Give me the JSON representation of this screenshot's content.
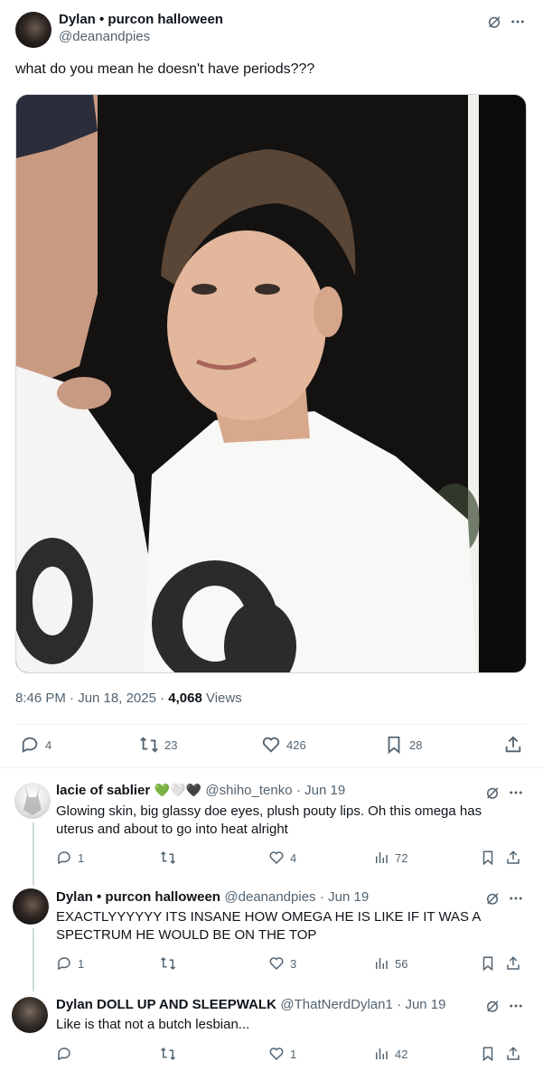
{
  "main_tweet": {
    "display_name": "Dylan • purcon halloween",
    "handle": "@deanandpies",
    "text": "what do you mean he doesn't have periods???",
    "time": "8:46 PM · Jun 18, 2025 · ",
    "views_count": "4,068",
    "views_label": " Views",
    "stats": {
      "replies": "4",
      "reposts": "23",
      "likes": "426",
      "bookmarks": "28"
    }
  },
  "replies": [
    {
      "display_name": "lacie of sablier",
      "emoji": "💚🤍🖤",
      "handle": "@shiho_tenko",
      "date": "· Jun 19",
      "text": "Glowing skin, big glassy doe eyes, plush pouty lips. Oh this omega has uterus and about to go into heat alright",
      "replies": "1",
      "reposts": "",
      "likes": "4",
      "views": "72"
    },
    {
      "display_name": "Dylan • purcon halloween",
      "emoji": "",
      "handle": "@deanandpies",
      "date": "· Jun 19",
      "text": "EXACTLYYYYYY ITS INSANE HOW OMEGA HE IS LIKE IF IT WAS A SPECTRUM HE WOULD BE ON THE TOP",
      "replies": "1",
      "reposts": "",
      "likes": "3",
      "views": "56"
    },
    {
      "display_name": "Dylan DOLL UP AND SLEEPWALK",
      "emoji": "",
      "handle": "@ThatNerdDylan1",
      "date": "· Jun 19",
      "text": "Like is that not a butch lesbian...",
      "replies": "",
      "reposts": "",
      "likes": "1",
      "views": "42"
    }
  ],
  "colors": {
    "text": "#0f1419",
    "muted": "#536471",
    "divider": "#eff3f4",
    "heart_green": "#78b159"
  }
}
